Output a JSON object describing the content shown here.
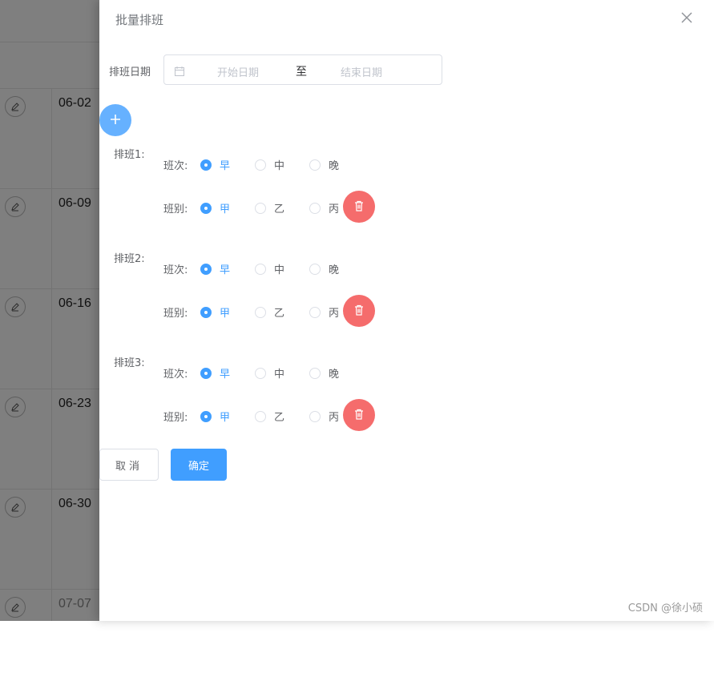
{
  "background": {
    "dates": [
      "06-02",
      "06-09",
      "06-16",
      "06-23",
      "06-30",
      "07-07"
    ]
  },
  "drawer": {
    "title": "批量排班",
    "date_label": "排班日期",
    "start_placeholder": "开始日期",
    "range_separator": "至",
    "end_placeholder": "结束日期",
    "groups": [
      {
        "label": "排班1:",
        "shift_label": "班次:",
        "shift_options": [
          "早",
          "中",
          "晚"
        ],
        "shift_selected": "早",
        "team_label": "班别:",
        "team_options": [
          "甲",
          "乙",
          "丙"
        ],
        "team_selected": "甲"
      },
      {
        "label": "排班2:",
        "shift_label": "班次:",
        "shift_options": [
          "早",
          "中",
          "晚"
        ],
        "shift_selected": "早",
        "team_label": "班别:",
        "team_options": [
          "甲",
          "乙",
          "丙"
        ],
        "team_selected": "甲"
      },
      {
        "label": "排班3:",
        "shift_label": "班次:",
        "shift_options": [
          "早",
          "中",
          "晚"
        ],
        "shift_selected": "早",
        "team_label": "班别:",
        "team_options": [
          "甲",
          "乙",
          "丙"
        ],
        "team_selected": "甲"
      }
    ],
    "cancel_label": "取消",
    "confirm_label": "确定"
  },
  "watermark": "CSDN @徐小硕",
  "colors": {
    "primary": "#409eff",
    "add_button": "#66b1ff",
    "danger": "#f56c6c"
  },
  "icons": {
    "close": "close-icon",
    "calendar": "calendar-icon",
    "add": "plus-icon",
    "delete": "trash-icon",
    "edit": "edit-icon"
  }
}
